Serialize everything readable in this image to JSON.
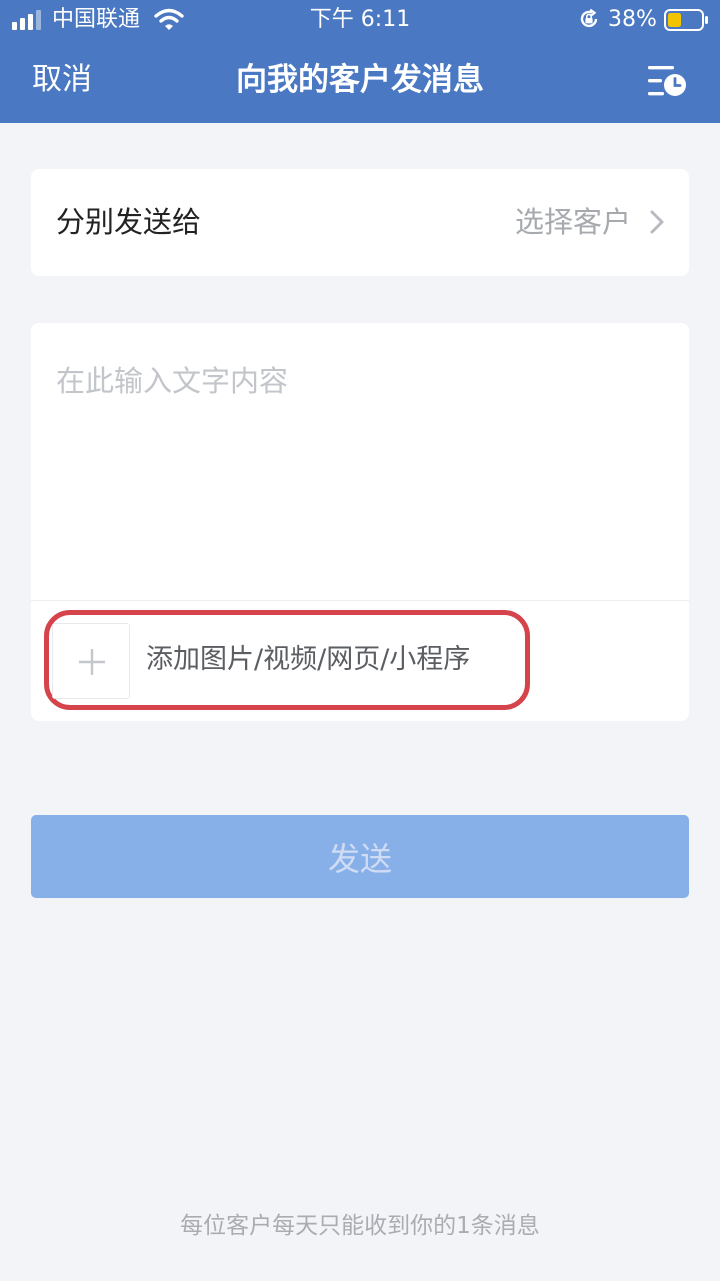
{
  "status_bar": {
    "carrier": "中国联通",
    "time": "下午 6:11",
    "battery_percent": "38%",
    "icons": [
      "signal-icon",
      "wifi-icon",
      "rotation-lock-icon",
      "battery-icon"
    ]
  },
  "navbar": {
    "cancel_label": "取消",
    "title": "向我的客户发消息",
    "history_icon": "list-clock-icon"
  },
  "recipients": {
    "label": "分别发送给",
    "action": "选择客户"
  },
  "composer": {
    "placeholder": "在此输入文字内容",
    "value": "",
    "attach_label": "添加图片/视频/网页/小程序"
  },
  "send_button": {
    "label": "发送",
    "enabled": false
  },
  "footer_note": "每位客户每天只能收到你的1条消息",
  "colors": {
    "header": "#4a78c2",
    "background": "#f3f4f8",
    "send_button_disabled": "#88b0e8",
    "highlight_annotation": "#d5434b"
  }
}
